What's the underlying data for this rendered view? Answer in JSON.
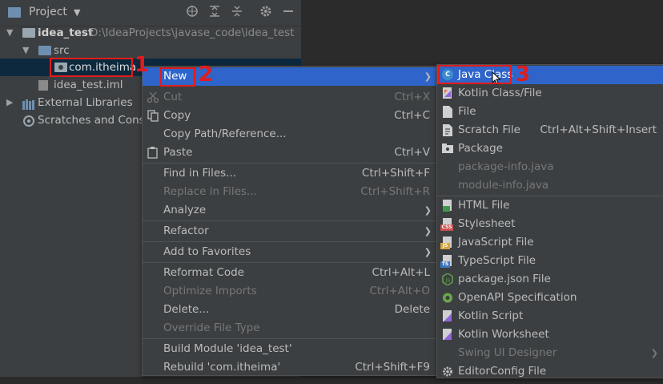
{
  "panel": {
    "title": "Project",
    "title_arrow": "▼",
    "toolbar_icons": [
      "target-icon",
      "expand-all-icon",
      "collapse-all-icon",
      "gear-icon",
      "minimize-icon"
    ]
  },
  "tree": {
    "root_name": "idea_test",
    "root_path": "D:\\IdeaProjects\\javase_code\\idea_test",
    "src": "src",
    "package": "com.itheima",
    "iml": "idea_test.iml",
    "external": "External Libraries",
    "scratches": "Scratches and Conso"
  },
  "annotations": {
    "n1": "1",
    "n2": "2",
    "n3": "3"
  },
  "context_menu": {
    "new": "New",
    "cut": "Cut",
    "cut_sc": "Ctrl+X",
    "copy": "Copy",
    "copy_sc": "Ctrl+C",
    "copy_path": "Copy Path/Reference...",
    "paste": "Paste",
    "paste_sc": "Ctrl+V",
    "find": "Find in Files...",
    "find_sc": "Ctrl+Shift+F",
    "replace": "Replace in Files...",
    "replace_sc": "Ctrl+Shift+R",
    "analyze": "Analyze",
    "refactor": "Refactor",
    "favorites": "Add to Favorites",
    "reformat": "Reformat Code",
    "reformat_sc": "Ctrl+Alt+L",
    "optimize": "Optimize Imports",
    "optimize_sc": "Ctrl+Alt+O",
    "delete": "Delete...",
    "delete_sc": "Delete",
    "override": "Override File Type",
    "build": "Build Module 'idea_test'",
    "rebuild": "Rebuild 'com.itheima'",
    "rebuild_sc": "Ctrl+Shift+F9"
  },
  "new_menu": {
    "java_class": "Java Class",
    "kotlin_class": "Kotlin Class/File",
    "file": "File",
    "scratch": "Scratch File",
    "scratch_sc": "Ctrl+Alt+Shift+Insert",
    "package": "Package",
    "package_info": "package-info.java",
    "module_info": "module-info.java",
    "html": "HTML File",
    "stylesheet": "Stylesheet",
    "js": "JavaScript File",
    "ts": "TypeScript File",
    "pkg_json": "package.json File",
    "openapi": "OpenAPI Specification",
    "kotlin_script": "Kotlin Script",
    "kotlin_ws": "Kotlin Worksheet",
    "swing": "Swing UI Designer",
    "editorconfig": "EditorConfig File",
    "badge_css": "CSS",
    "badge_js": "JS",
    "badge_ts": "TS",
    "badge_c": "C"
  },
  "colors": {
    "selection": "#2f65ca",
    "annotation": "#e21b1b",
    "panel_bg": "#3c3f41"
  }
}
